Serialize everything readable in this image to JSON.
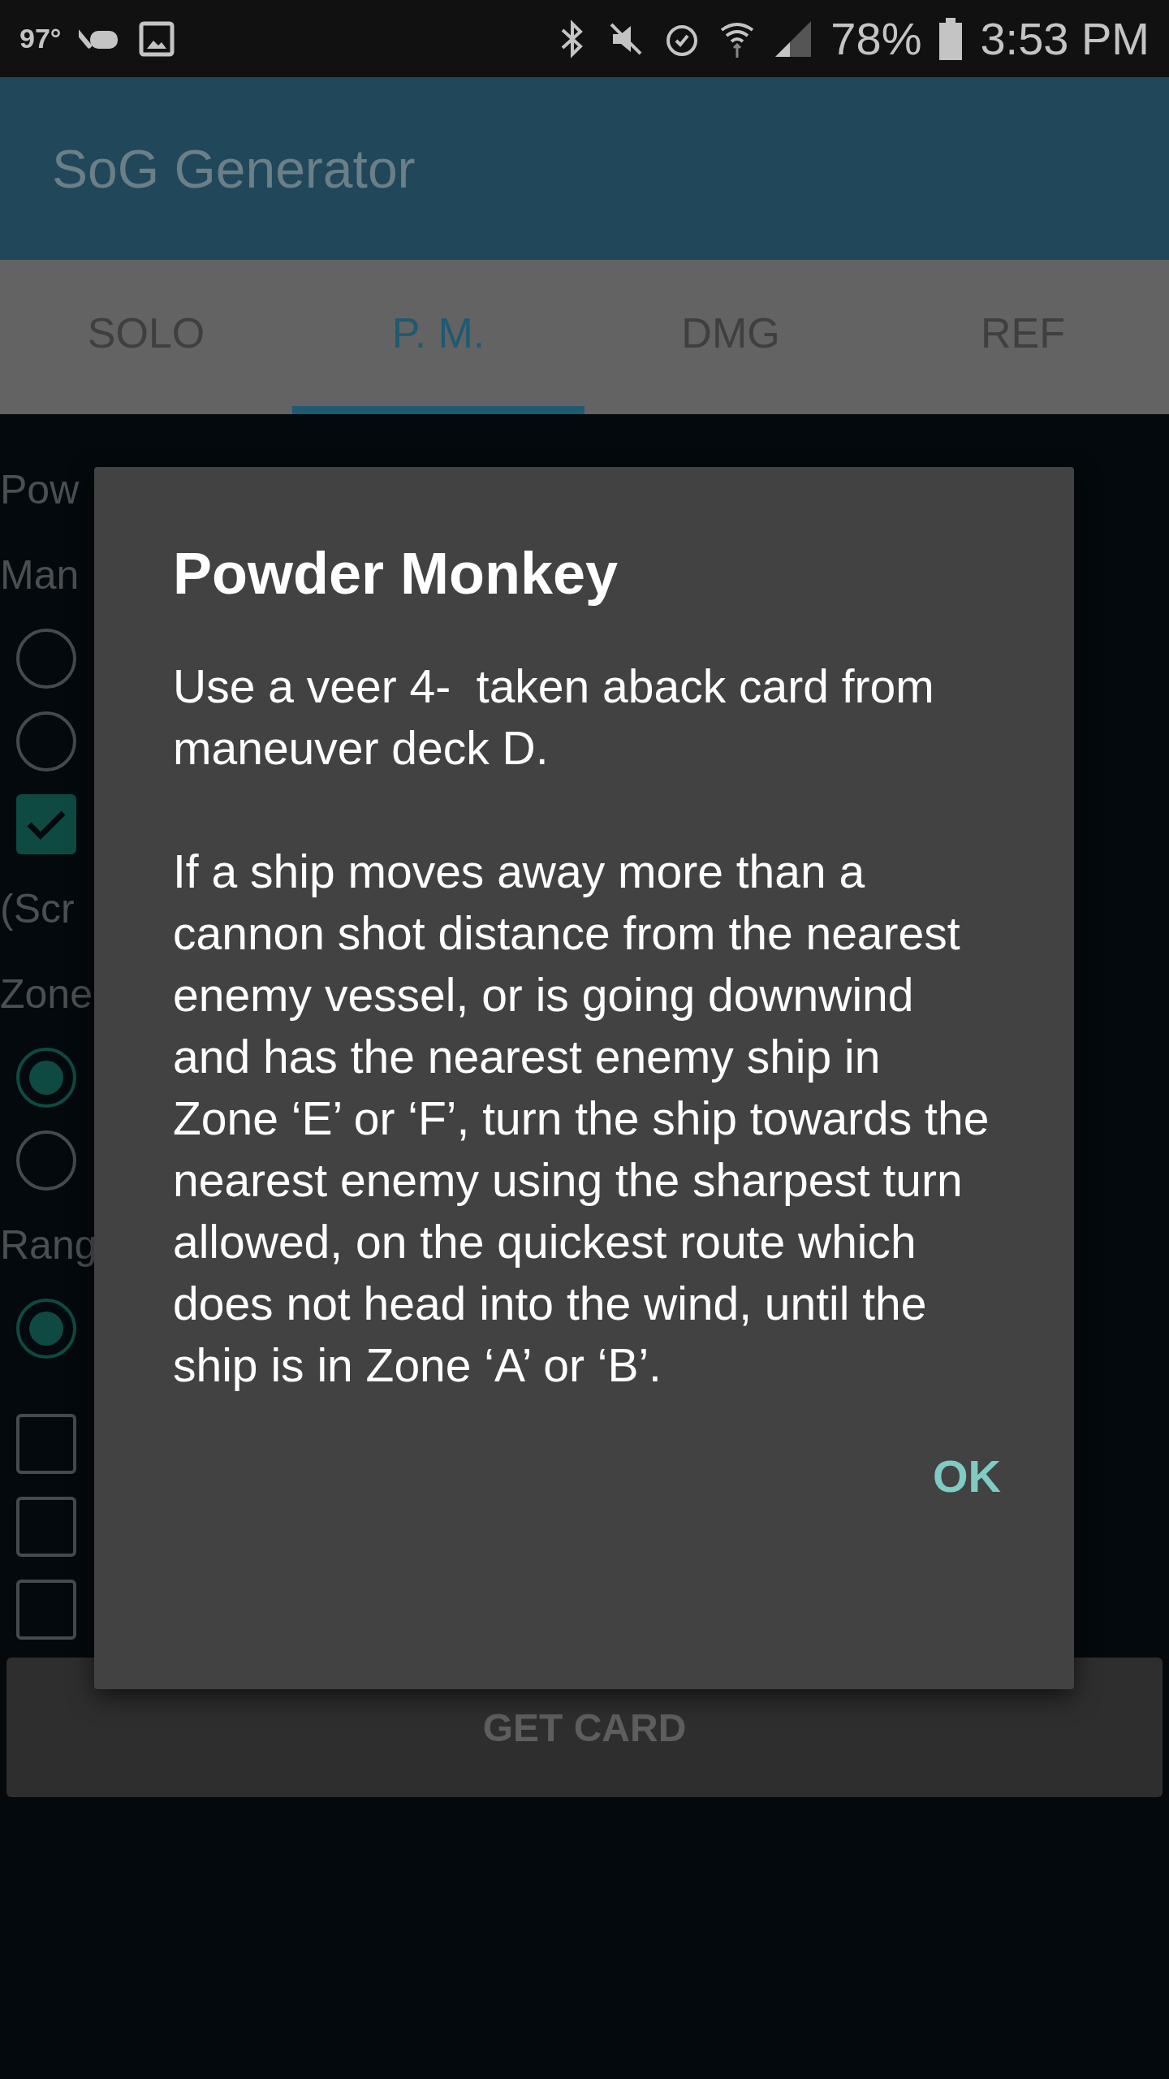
{
  "status_bar": {
    "temperature": "97°",
    "battery": "78%",
    "time": "3:53 PM"
  },
  "app_bar": {
    "title": "SoG Generator"
  },
  "tabs": [
    {
      "label": "SOLO",
      "selected": false
    },
    {
      "label": "P. M.",
      "selected": true
    },
    {
      "label": "DMG",
      "selected": false
    },
    {
      "label": "REF",
      "selected": false
    }
  ],
  "background_items": [
    {
      "kind": "label",
      "text": "Pow"
    },
    {
      "kind": "label",
      "text": "Man"
    },
    {
      "kind": "radio",
      "selected": false
    },
    {
      "kind": "radio",
      "selected": false
    },
    {
      "kind": "checkbox",
      "checked": true
    },
    {
      "kind": "label",
      "text": "(Scr"
    },
    {
      "kind": "label",
      "text": "Zone"
    },
    {
      "kind": "radio",
      "selected": true
    },
    {
      "kind": "radio",
      "selected": false
    },
    {
      "kind": "label",
      "text": "Rang"
    },
    {
      "kind": "radio",
      "selected": true
    },
    {
      "kind": "spacer"
    },
    {
      "kind": "checkbox",
      "checked": false
    },
    {
      "kind": "checkbox",
      "checked": false
    },
    {
      "kind": "checkbox",
      "checked": false
    }
  ],
  "get_card_button": "GET CARD",
  "dialog": {
    "title": "Powder Monkey",
    "paragraphs": [
      "Use a veer 4-  taken aback card from maneuver deck D.",
      "If a ship moves away more than a cannon shot distance from the nearest enemy vessel, or is going downwind and has the nearest enemy ship in Zone ‘E’ or ‘F’, turn the ship towards the nearest enemy using the sharpest turn allowed, on the quickest route which does not head into the wind, until the ship is in Zone ‘A’ or ‘B’."
    ],
    "button": "OK"
  }
}
